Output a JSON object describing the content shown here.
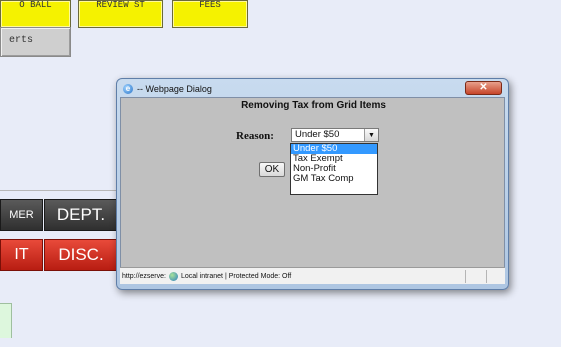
{
  "background": {
    "top_buttons": [
      "O BALL",
      "REVIEW ST",
      "FEES"
    ],
    "parts_button": "erts",
    "customer_button": "MER",
    "dept_button": "DEPT.",
    "t_button": "IT",
    "disc_button": "DISC."
  },
  "dialog": {
    "title": "-- Webpage Dialog",
    "close_glyph": "✕",
    "ie_glyph": "e",
    "heading": "Removing Tax from Grid Items",
    "reason_label": "Reason:",
    "selected_value": "Under $50",
    "arrow_glyph": "▼",
    "options": [
      "Under $50",
      "Tax Exempt",
      "Non-Profit",
      "GM Tax Comp"
    ],
    "ok_label": "OK",
    "status_text": "http://ezserve:",
    "status_zone": "Local intranet | Protected Mode: Off"
  },
  "colors": {
    "yellow_button": "#f5f200",
    "red_button": "#c8281b",
    "dropdown_highlight": "#3399ff"
  }
}
